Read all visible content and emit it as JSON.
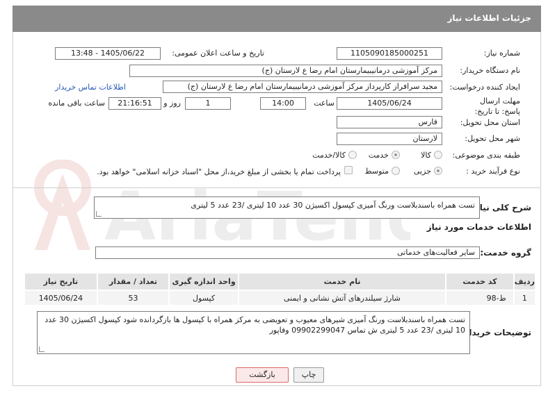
{
  "header": {
    "title": "جزئیات اطلاعات نیاز"
  },
  "form": {
    "need_number_label": "شماره نیاز:",
    "need_number_value": "1105090185000251",
    "announce_label": "تاریخ و ساعت اعلان عمومی:",
    "announce_value": "1405/06/22 - 13:48",
    "buyer_org_label": "نام دستگاه خریدار:",
    "buyer_org_value": "مرکز آموزشی درمانیبیمارستان امام رضا  ع  لارستان (ج)",
    "creator_label": "ایجاد کننده درخواست:",
    "creator_value": "مجید سرافراز کارپرداز  مرکز آموزشی درمانیبیمارستان امام رضا  ع  لارستان (ج)",
    "buyer_contact_link": "اطلاعات تماس خریدار",
    "deadline_label": "مهلت ارسال پاسخ: تا تاریخ:",
    "deadline_date": "1405/06/24",
    "time_label": "ساعت",
    "deadline_time": "14:00",
    "days_value": "1",
    "days_label": "روز و",
    "remaining_value": "21:16:51",
    "remaining_label": "ساعت باقی مانده",
    "province_label": "استان محل تحویل:",
    "province_value": "فارس",
    "city_label": "شهر محل تحویل:",
    "city_value": "لارستان",
    "category_label": "طبقه بندی موضوعی:",
    "category_options": [
      "کالا",
      "خدمت",
      "کالا/خدمت"
    ],
    "process_label": "نوع فرآیند خرید :",
    "process_options": [
      "جزیی",
      "متوسط"
    ],
    "payment_note": "پرداخت تمام یا بخشی از مبلغ خرید،از محل \"اسناد خزانه اسلامی\" خواهد بود."
  },
  "summary": {
    "label": "شرح کلی نیاز:",
    "value": "تست همراه باسندبلاست ورنگ آمیزی کپسول اکسیژن 30 عدد 10 لیتری /23 عدد 5 لیتری"
  },
  "services": {
    "section_title": "اطلاعات خدمات مورد نیاز",
    "group_label": "گروه خدمت:",
    "group_value": "سایر فعالیت‌های خدماتی",
    "columns": [
      "ردیف",
      "کد خدمت",
      "نام خدمت",
      "واحد اندازه گیری",
      "تعداد / مقدار",
      "تاریخ نیاز"
    ],
    "rows": [
      [
        "1",
        "ط-98",
        "شارژ سیلندرهای آتش نشانی و ایمنی",
        "کپسول",
        "53",
        "1405/06/24"
      ]
    ]
  },
  "buyer_notes": {
    "label": "توضیحات خریدار:",
    "value": "تست همراه باسندبلاست ورنگ آمیزی شیرهای معیوب و تعویضی به مرکز همراه با کپسول ها بازگردانده شود  کپسول اکسیژن 30 عدد 10 لیتری /23 عدد 5 لیتری  ش تماس 09902299047 وفاپور"
  },
  "buttons": {
    "print": "چاپ",
    "back": "بازگشت"
  },
  "colors": {
    "header": "#8a8a8a",
    "link": "#2457b6",
    "back_border": "#dd6666"
  }
}
